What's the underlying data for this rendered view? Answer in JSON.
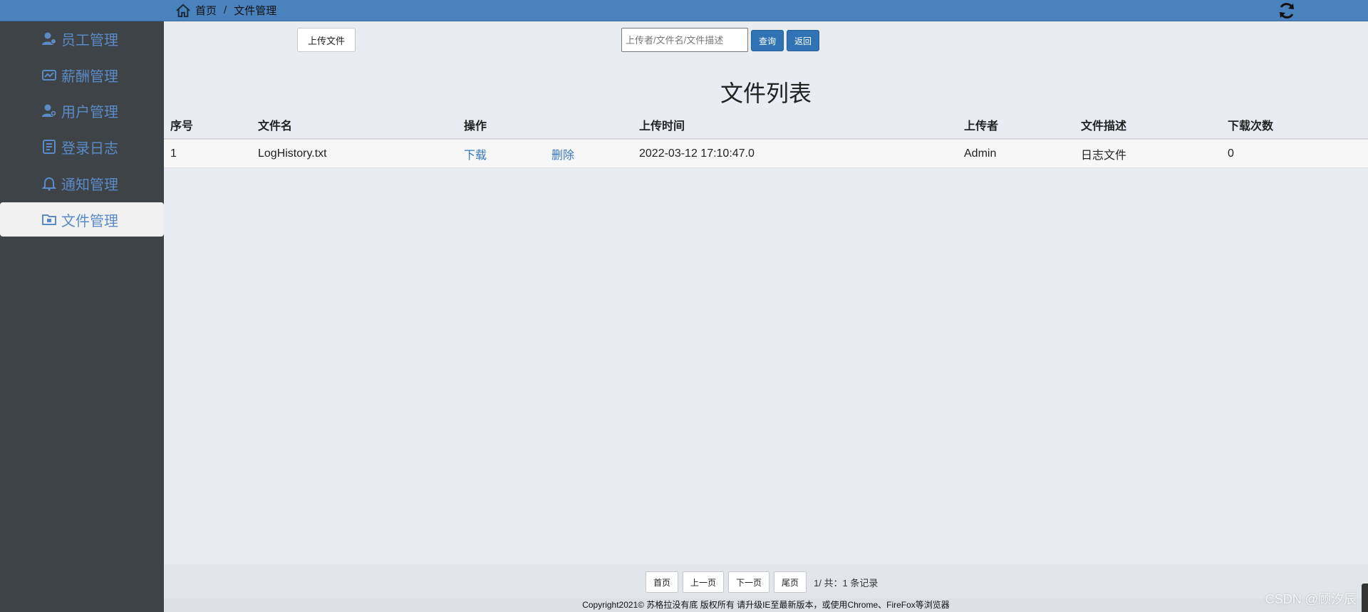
{
  "breadcrumb": {
    "home": "首页",
    "separator": "/",
    "current": "文件管理"
  },
  "sidebar": {
    "items": [
      {
        "label": "员工管理",
        "icon": "employee-icon"
      },
      {
        "label": "薪酬管理",
        "icon": "salary-icon"
      },
      {
        "label": "用户管理",
        "icon": "user-icon"
      },
      {
        "label": "登录日志",
        "icon": "log-icon"
      },
      {
        "label": "通知管理",
        "icon": "bell-icon"
      },
      {
        "label": "文件管理",
        "icon": "folder-icon",
        "active": true
      }
    ]
  },
  "toolbar": {
    "upload_label": "上传文件",
    "search_placeholder": "上传者/文件名/文件描述",
    "query_label": "查询",
    "back_label": "返回"
  },
  "page_title": "文件列表",
  "table": {
    "headers": [
      "序号",
      "文件名",
      "操作",
      "上传时间",
      "上传者",
      "文件描述",
      "下载次数"
    ],
    "rows": [
      {
        "index": "1",
        "filename": "LogHistory.txt",
        "download": "下载",
        "delete": "删除",
        "upload_time": "2022-03-12 17:10:47.0",
        "uploader": "Admin",
        "description": "日志文件",
        "downloads": "0"
      }
    ]
  },
  "pager": {
    "first": "首页",
    "prev": "上一页",
    "next": "下一页",
    "last": "尾页",
    "info": "1/ 共：1 条记录"
  },
  "footer": "Copyright2021© 苏格拉没有底 版权所有 请升级IE至最新版本，或使用Chrome、FireFox等浏览器",
  "watermark": "CSDN @顾汐辰",
  "colors": {
    "topbar": "#4a82bd",
    "sidebar": "#3e4347",
    "accent": "#2f73b5",
    "link": "#3677bb"
  }
}
